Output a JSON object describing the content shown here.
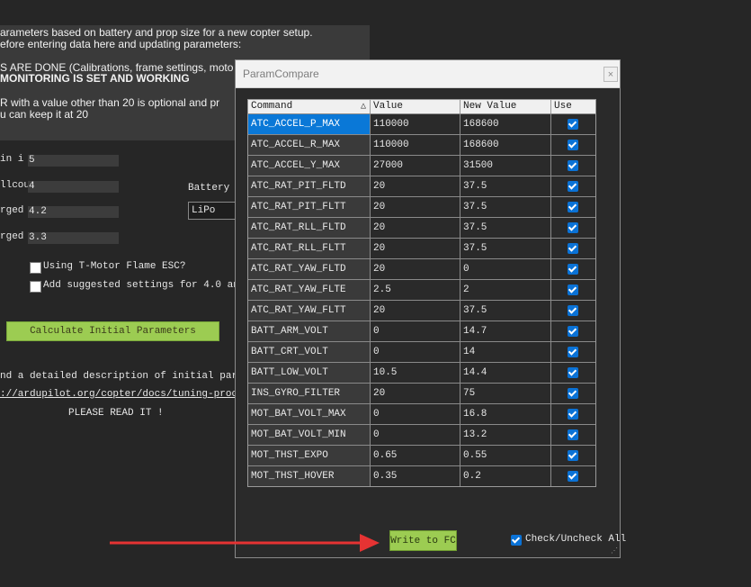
{
  "background": {
    "notice_lines": [
      "arameters based on battery and prop size for a new copter setup.",
      "efore entering data here and updating parameters:",
      "",
      "S ARE DONE (Calibrations, frame settings, moto",
      " MONITORING IS SET AND WORKING",
      "",
      "R with a value other than 20 is optional and pr",
      "u can keep it at 20"
    ],
    "fields": [
      {
        "label": " in i",
        "value": "5"
      },
      {
        "label": "llcou",
        "value": "4"
      },
      {
        "label": "rged v",
        "value": "4.2"
      },
      {
        "label": "rged ",
        "value": "3.3"
      }
    ],
    "battery_label": "Battery C",
    "battery_value": "LiPo",
    "check_tmotor": "Using T-Motor Flame ESC?",
    "check_suggested": "Add suggested settings for 4.0 and v",
    "calc_button": "Calculate Initial Parameters",
    "desc_line": "nd a detailed description of initial paramet",
    "link_line": "://ardupilot.org/copter/docs/tuning-process-",
    "read_line": "PLEASE READ IT !"
  },
  "dialog": {
    "title": "ParamCompare",
    "close_icon": "×",
    "columns": {
      "command": "Command",
      "value": "Value",
      "new_value": "New Value",
      "use": "Use"
    },
    "sort_icon": "△",
    "rows": [
      {
        "command": "ATC_ACCEL_P_MAX",
        "value": "110000",
        "new_value": "168600",
        "use": true,
        "selected": true
      },
      {
        "command": "ATC_ACCEL_R_MAX",
        "value": "110000",
        "new_value": "168600",
        "use": true
      },
      {
        "command": "ATC_ACCEL_Y_MAX",
        "value": "27000",
        "new_value": "31500",
        "use": true
      },
      {
        "command": "ATC_RAT_PIT_FLTD",
        "value": "20",
        "new_value": "37.5",
        "use": true
      },
      {
        "command": "ATC_RAT_PIT_FLTT",
        "value": "20",
        "new_value": "37.5",
        "use": true
      },
      {
        "command": "ATC_RAT_RLL_FLTD",
        "value": "20",
        "new_value": "37.5",
        "use": true
      },
      {
        "command": "ATC_RAT_RLL_FLTT",
        "value": "20",
        "new_value": "37.5",
        "use": true
      },
      {
        "command": "ATC_RAT_YAW_FLTD",
        "value": "20",
        "new_value": "0",
        "use": true
      },
      {
        "command": "ATC_RAT_YAW_FLTE",
        "value": "2.5",
        "new_value": "2",
        "use": true
      },
      {
        "command": "ATC_RAT_YAW_FLTT",
        "value": "20",
        "new_value": "37.5",
        "use": true
      },
      {
        "command": "BATT_ARM_VOLT",
        "value": "0",
        "new_value": "14.7",
        "use": true
      },
      {
        "command": "BATT_CRT_VOLT",
        "value": "0",
        "new_value": "14",
        "use": true
      },
      {
        "command": "BATT_LOW_VOLT",
        "value": "10.5",
        "new_value": "14.4",
        "use": true
      },
      {
        "command": "INS_GYRO_FILTER",
        "value": "20",
        "new_value": "75",
        "use": true
      },
      {
        "command": "MOT_BAT_VOLT_MAX",
        "value": "0",
        "new_value": "16.8",
        "use": true
      },
      {
        "command": "MOT_BAT_VOLT_MIN",
        "value": "0",
        "new_value": "13.2",
        "use": true
      },
      {
        "command": "MOT_THST_EXPO",
        "value": "0.65",
        "new_value": "0.55",
        "use": true
      },
      {
        "command": "MOT_THST_HOVER",
        "value": "0.35",
        "new_value": "0.2",
        "use": true
      }
    ],
    "write_button": "Write to FC",
    "check_all_label": "Check/Uncheck All",
    "check_all_checked": true
  },
  "annotation": {
    "arrow_color": "#e53333"
  }
}
